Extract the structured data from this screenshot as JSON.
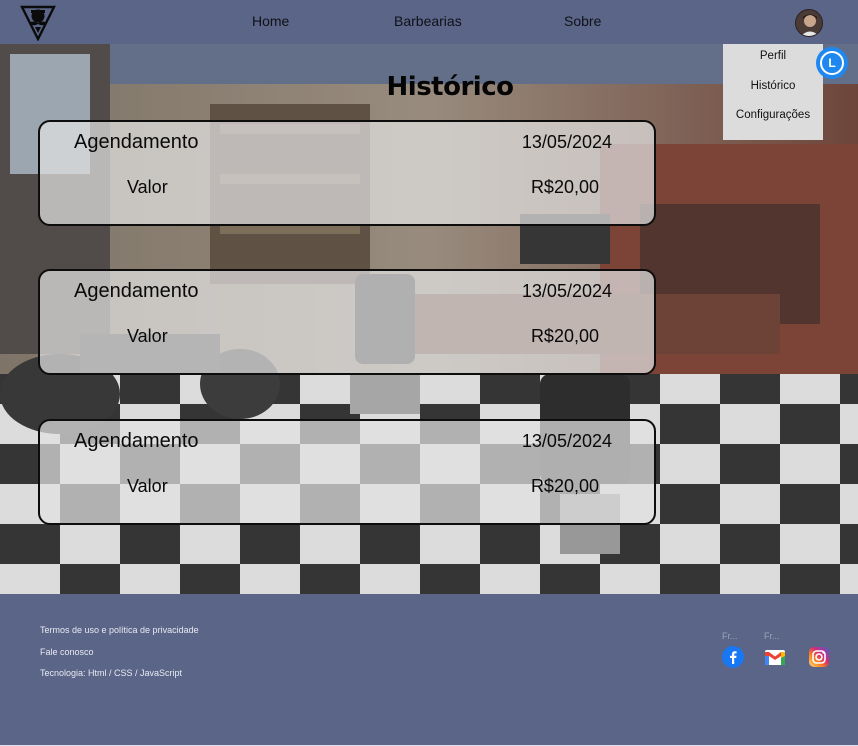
{
  "nav": {
    "home": "Home",
    "barbearias": "Barbearias",
    "sobre": "Sobre"
  },
  "page": {
    "title": "Histórico"
  },
  "history": [
    {
      "label": "Agendamento",
      "date": "13/05/2024",
      "value_label": "Valor",
      "value": "R$20,00"
    },
    {
      "label": "Agendamento",
      "date": "13/05/2024",
      "value_label": "Valor",
      "value": "R$20,00"
    },
    {
      "label": "Agendamento",
      "date": "13/05/2024",
      "value_label": "Valor",
      "value": "R$20,00"
    }
  ],
  "dropdown": {
    "items": [
      "Perfil",
      "Histórico",
      "Configurações"
    ]
  },
  "bubble": {
    "letter": "L"
  },
  "footer": {
    "links": [
      "Termos de uso e política de privacidade",
      "Fale conosco",
      "Tecnologia: Html / CSS / JavaScript"
    ],
    "truncated_labels": [
      "Fr...",
      "Fr..."
    ]
  },
  "icons": {
    "logo": "barber-mustache-logo-icon",
    "facebook": "facebook-icon",
    "gmail": "gmail-icon",
    "instagram": "instagram-icon"
  },
  "colors": {
    "header_bg": "#5b6587",
    "card_bg": "#e2e2e2",
    "dropdown_bg": "#dcdcdc",
    "bubble": "#1e88f0"
  }
}
